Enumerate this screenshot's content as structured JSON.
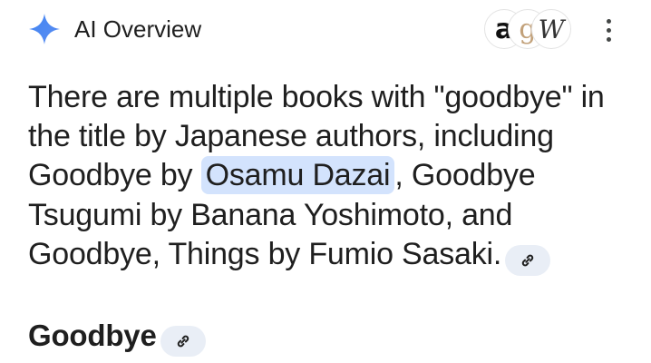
{
  "header": {
    "title": "AI Overview",
    "sources": [
      "a",
      "g",
      "W"
    ],
    "accent_color": "#4285f4"
  },
  "overview": {
    "text_before": "There are multiple books with \"goodbye\" in the title by Japanese authors, including Goodbye by ",
    "highlight": "Osamu Dazai",
    "text_after": ", Goodbye Tsugumi by Banana Yoshimoto, and Goodbye, Things by Fumio Sasaki."
  },
  "section": {
    "heading": "Goodbye"
  }
}
